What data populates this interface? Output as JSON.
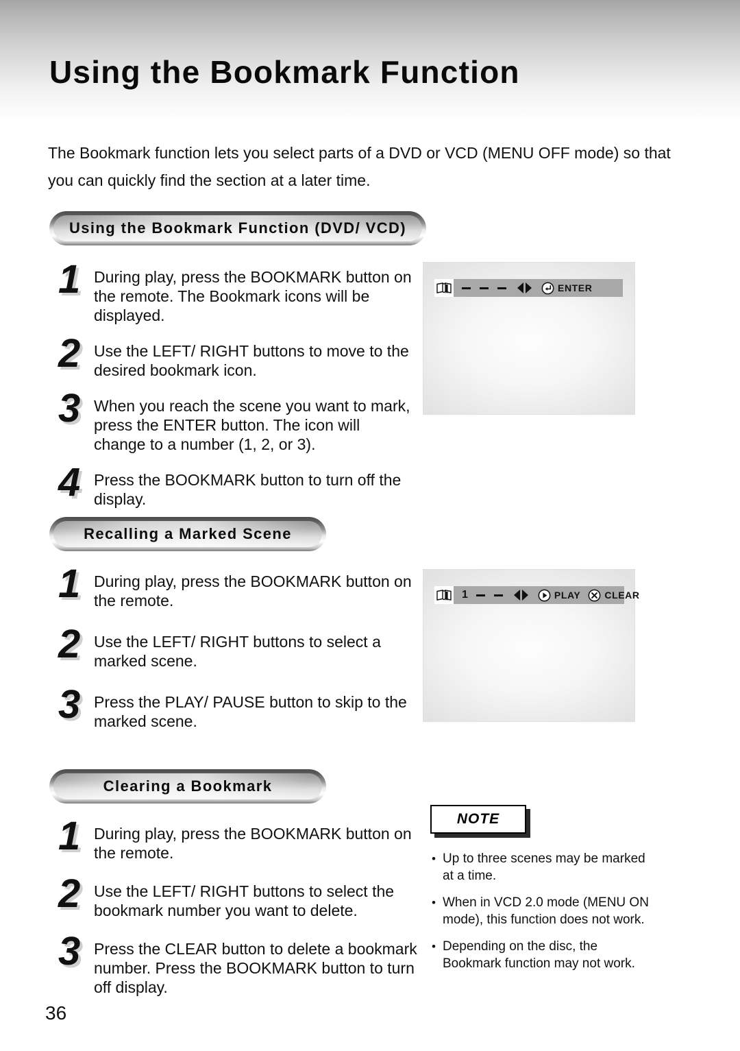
{
  "page": {
    "title": "Using the Bookmark Function",
    "number": "36",
    "intro": "The Bookmark function lets you select parts of a DVD or VCD (MENU OFF mode) so that you can quickly find the section at a later time."
  },
  "sections": [
    {
      "banner": "Using the Bookmark Function (DVD/ VCD)",
      "steps": [
        {
          "num": "1",
          "text": "During play, press the BOOKMARK button on the remote. The Bookmark icons will be displayed."
        },
        {
          "num": "2",
          "text": "Use the LEFT/ RIGHT buttons to move to the desired bookmark icon."
        },
        {
          "num": "3",
          "text": "When you reach the scene you want to mark, press the ENTER button. The icon will change to a number (1, 2, or 3)."
        },
        {
          "num": "4",
          "text": "Press the BOOKMARK button to turn off the display."
        }
      ]
    },
    {
      "banner": "Recalling a Marked Scene",
      "steps": [
        {
          "num": "1",
          "text": "During play, press the BOOKMARK button on the remote."
        },
        {
          "num": "2",
          "text": "Use the LEFT/ RIGHT buttons to select a marked scene."
        },
        {
          "num": "3",
          "text": "Press the PLAY/ PAUSE button to skip to the marked scene."
        }
      ]
    },
    {
      "banner": "Clearing a Bookmark",
      "steps": [
        {
          "num": "1",
          "text": "During play, press the BOOKMARK button on the remote."
        },
        {
          "num": "2",
          "text": "Use the LEFT/ RIGHT buttons to select the bookmark number you want to delete."
        },
        {
          "num": "3",
          "text": "Press the CLEAR button to delete a bookmark number. Press the BOOKMARK button to turn off display."
        }
      ]
    }
  ],
  "screens": [
    {
      "name": "bookmark-osd-empty",
      "osd": {
        "book_icon": "open-book-bookmark-icon",
        "marks": [
          "-",
          "-",
          "-"
        ],
        "arrows_icon": "left-right-arrows-icon",
        "action_icon": "enter-return-icon",
        "action_label": "ENTER"
      }
    },
    {
      "name": "bookmark-osd-marked",
      "osd": {
        "book_icon": "open-book-bookmark-icon",
        "number": "1",
        "marks": [
          "-",
          "-"
        ],
        "arrows_icon": "left-right-arrows-icon",
        "play_icon": "play-circle-icon",
        "play_label": "PLAY",
        "clear_icon": "x-circle-icon",
        "clear_label": "CLEAR"
      }
    }
  ],
  "note": {
    "title": "NOTE",
    "bullet": "•",
    "items": [
      "Up to three scenes may be marked at a time.",
      "When in VCD 2.0 mode (MENU ON mode), this function does not work.",
      "Depending on the disc, the Bookmark function may not work."
    ]
  },
  "colors": {
    "text": "#111111",
    "osd_bar": "#a8a8a8",
    "screen_bg": "#f2f2f2",
    "number_shadow": "#cfcfcf"
  }
}
